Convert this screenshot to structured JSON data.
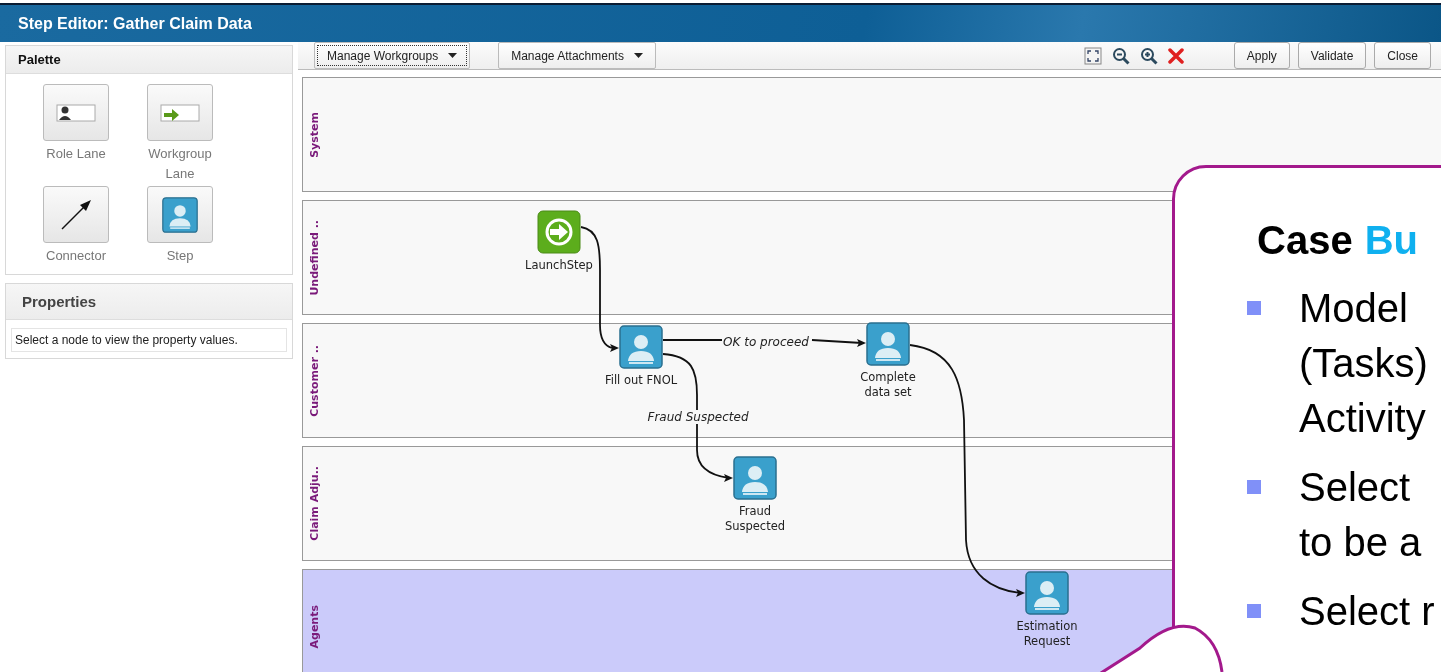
{
  "window": {
    "title": "Step Editor: Gather Claim Data"
  },
  "palette": {
    "title": "Palette",
    "items": [
      {
        "kind": "role-lane",
        "label": "Role Lane"
      },
      {
        "kind": "workgroup-lane",
        "label": "Workgroup Lane"
      },
      {
        "kind": "connector",
        "label": "Connector"
      },
      {
        "kind": "step",
        "label": "Step"
      }
    ]
  },
  "properties": {
    "title": "Properties",
    "hint": "Select a node to view the property values."
  },
  "toolbar": {
    "menus": [
      {
        "label": "Manage Workgroups",
        "focused": true
      },
      {
        "label": "Manage Attachments",
        "focused": false
      }
    ],
    "tools": [
      {
        "kind": "fit"
      },
      {
        "kind": "zoom-out"
      },
      {
        "kind": "zoom-in"
      },
      {
        "kind": "delete"
      }
    ],
    "buttons": [
      "Apply",
      "Validate",
      "Close"
    ]
  },
  "lanes": [
    {
      "label": "System",
      "selected": false
    },
    {
      "label": "Undefined ..",
      "selected": false
    },
    {
      "label": "Customer ..",
      "selected": false
    },
    {
      "label": "Claim Adju..",
      "selected": false
    },
    {
      "label": "Agents",
      "selected": true
    }
  ],
  "nodes": [
    {
      "kind": "launch",
      "label": "LaunchStep"
    },
    {
      "kind": "step",
      "label": "Fill out FNOL"
    },
    {
      "kind": "step",
      "label": "Complete data set"
    },
    {
      "kind": "step",
      "label": "Fraud Suspected"
    },
    {
      "kind": "step",
      "label": "Estimation Request"
    }
  ],
  "connectors": [
    {
      "kind": "plain"
    },
    {
      "kind": "labeled",
      "label": "OK to proceed"
    },
    {
      "kind": "labeled",
      "label": "Fraud Suspected"
    },
    {
      "kind": "plain"
    }
  ],
  "callout": {
    "title": "Case",
    "title_accent": "Bu",
    "bullets": [
      {
        "lines": [
          "Model",
          "(Tasks)",
          "Activity"
        ]
      },
      {
        "lines": [
          "Select",
          "to be a"
        ]
      },
      {
        "lines": [
          "Select r"
        ]
      }
    ]
  }
}
